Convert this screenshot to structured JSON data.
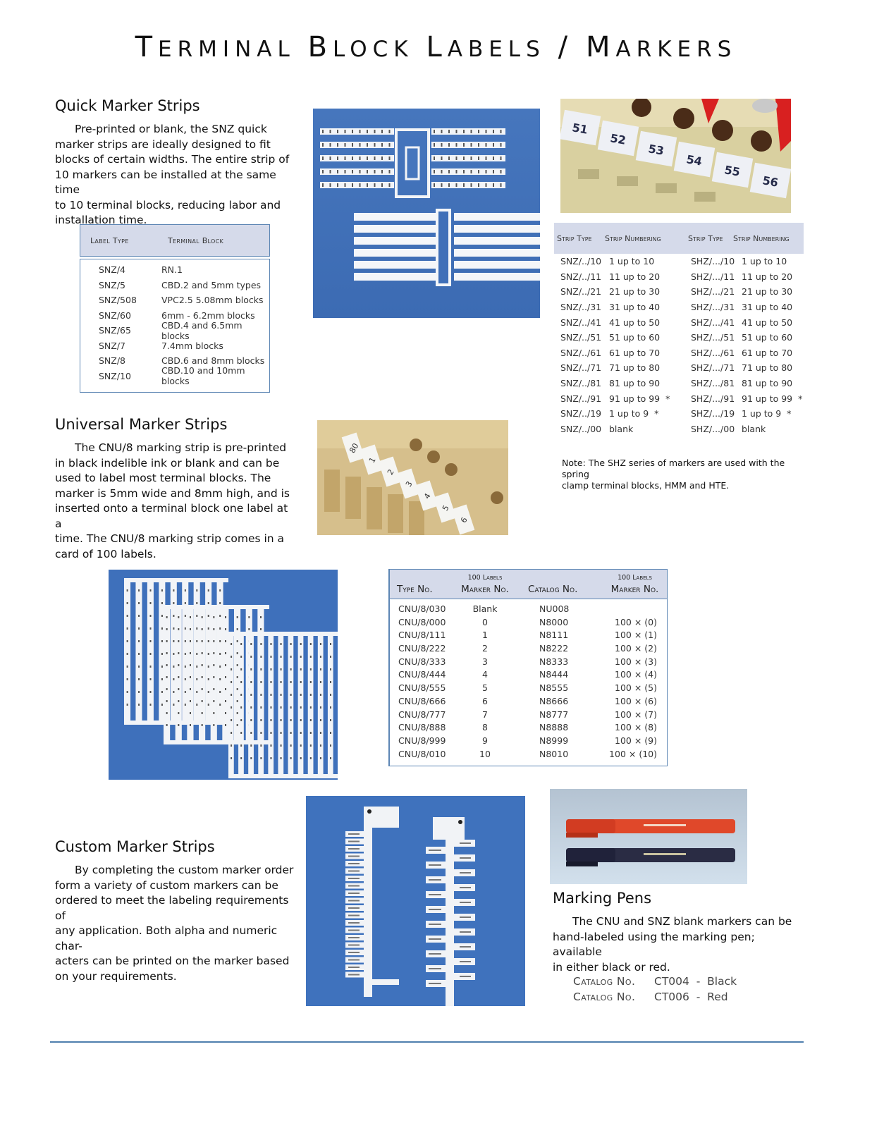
{
  "page": {
    "title_parts": [
      {
        "cap": "T",
        "rest": "ERMINAL"
      },
      {
        "cap": "B",
        "rest": "LOCK"
      },
      {
        "cap": "L",
        "rest": "ABELS"
      },
      {
        "cap": "/",
        "rest": ""
      },
      {
        "cap": "M",
        "rest": "ARKERS"
      }
    ],
    "accent_color": "#4f7fae",
    "header_fill": "#d5daea"
  },
  "quick": {
    "heading": "Quick Marker Strips",
    "lines": [
      "Pre-printed or blank, the SNZ quick",
      "marker strips are ideally designed to fit",
      "blocks of certain widths.  The entire strip of",
      "10 markers can be installed at the same time",
      "to 10 terminal blocks, reducing labor and",
      "installation time."
    ],
    "table": {
      "headers": [
        "Label Type",
        "Terminal Block"
      ],
      "rows": [
        [
          "SNZ/4",
          "RN.1"
        ],
        [
          "SNZ/5",
          "CBD.2 and 5mm types"
        ],
        [
          "SNZ/508",
          "VPC2.5  5.08mm blocks"
        ],
        [
          "SNZ/60",
          "6mm - 6.2mm blocks"
        ],
        [
          "SNZ/65",
          "CBD.4 and 6.5mm blocks"
        ],
        [
          "SNZ/7",
          "7.4mm blocks"
        ],
        [
          "SNZ/8",
          "CBD.6 and 8mm blocks"
        ],
        [
          "SNZ/10",
          "CBD.10 and 10mm blocks"
        ]
      ]
    },
    "photo_label": "SNZ quick marker strips on blue background",
    "photo2_numbers": [
      "51",
      "52",
      "53",
      "54",
      "55",
      "56"
    ]
  },
  "strip_table": {
    "headers": [
      "Strip Type",
      "Strip Numbering",
      "Strip Type",
      "Strip Numbering"
    ],
    "rows": [
      [
        "SNZ/../10",
        "1 up to 10",
        "SHZ/.../10",
        "1 up to 10"
      ],
      [
        "SNZ/../11",
        "11 up to 20",
        "SHZ/.../11",
        "11 up to 20"
      ],
      [
        "SNZ/../21",
        "21 up to 30",
        "SHZ/.../21",
        "21 up to 30"
      ],
      [
        "SNZ/../31",
        "31 up to 40",
        "SHZ/.../31",
        "31 up to 40"
      ],
      [
        "SNZ/../41",
        "41 up to 50",
        "SHZ/.../41",
        "41 up to 50"
      ],
      [
        "SNZ/../51",
        "51 up to 60",
        "SHZ/.../51",
        "51 up to 60"
      ],
      [
        "SNZ/../61",
        "61 up to 70",
        "SHZ/.../61",
        "61 up to 70"
      ],
      [
        "SNZ/../71",
        "71 up to 80",
        "SHZ/.../71",
        "71 up to 80"
      ],
      [
        "SNZ/../81",
        "81 up to 90",
        "SHZ/.../81",
        "81 up to 90"
      ],
      [
        "SNZ/../91",
        "91 up to 99  *",
        "SHZ/.../91",
        "91 up to 99  *"
      ],
      [
        "SNZ/../19",
        "1 up to 9  *",
        "SHZ/.../19",
        "1 up to 9  *"
      ],
      [
        "SNZ/../00",
        "blank",
        "SHZ/.../00",
        "blank"
      ]
    ],
    "note_lines": [
      "Note:  The SHZ series of markers are used with the spring",
      "clamp terminal blocks, HMM and HTE."
    ]
  },
  "universal": {
    "heading": "Universal Marker Strips",
    "lines": [
      "The CNU/8 marking strip is pre-printed",
      "in black indelible ink or blank and can be",
      "used to label most terminal blocks.  The",
      "marker is 5mm wide and 8mm high, and is",
      "inserted onto a terminal block one label at a",
      "time.  The CNU/8 marking strip comes in a",
      "card of 100 labels."
    ],
    "photo_numbers": [
      "80",
      "1",
      "2",
      "3",
      "4",
      "5",
      "6"
    ]
  },
  "cnu_table": {
    "headers": [
      {
        "top": "",
        "main": "Type No."
      },
      {
        "top": "100 Labels",
        "main": "Marker No."
      },
      {
        "top": "",
        "main": "Catalog No."
      },
      {
        "top": "100 Labels",
        "main": "Marker No."
      }
    ],
    "rows": [
      [
        "CNU/8/030",
        "Blank",
        "NU008",
        ""
      ],
      [
        "CNU/8/000",
        "0",
        "N8000",
        "100 × (0)"
      ],
      [
        "CNU/8/111",
        "1",
        "N8111",
        "100 × (1)"
      ],
      [
        "CNU/8/222",
        "2",
        "N8222",
        "100 × (2)"
      ],
      [
        "CNU/8/333",
        "3",
        "N8333",
        "100 × (3)"
      ],
      [
        "CNU/8/444",
        "4",
        "N8444",
        "100 × (4)"
      ],
      [
        "CNU/8/555",
        "5",
        "N8555",
        "100 × (5)"
      ],
      [
        "CNU/8/666",
        "6",
        "N8666",
        "100 × (6)"
      ],
      [
        "CNU/8/777",
        "7",
        "N8777",
        "100 × (7)"
      ],
      [
        "CNU/8/888",
        "8",
        "N8888",
        "100 × (8)"
      ],
      [
        "CNU/8/999",
        "9",
        "N8999",
        "100 × (9)"
      ],
      [
        "CNU/8/010",
        "10",
        "N8010",
        "100 × (10)"
      ]
    ]
  },
  "custom": {
    "heading": "Custom Marker Strips",
    "lines": [
      "By completing the custom marker order",
      "form a variety of custom markers can be",
      "ordered to meet the labeling requirements of",
      "any application. Both alpha and numeric char-",
      "acters can be printed on the marker based",
      "on your requirements."
    ]
  },
  "pens": {
    "heading": "Marking Pens",
    "lines": [
      "The CNU and SNZ blank markers can be",
      "hand-labeled using the marking pen; available",
      "in either black or red."
    ],
    "catalog": [
      {
        "label": "Catalog No.",
        "value": "CT004  -  Black"
      },
      {
        "label": "Catalog No.",
        "value": "CT006  -  Red"
      }
    ]
  }
}
